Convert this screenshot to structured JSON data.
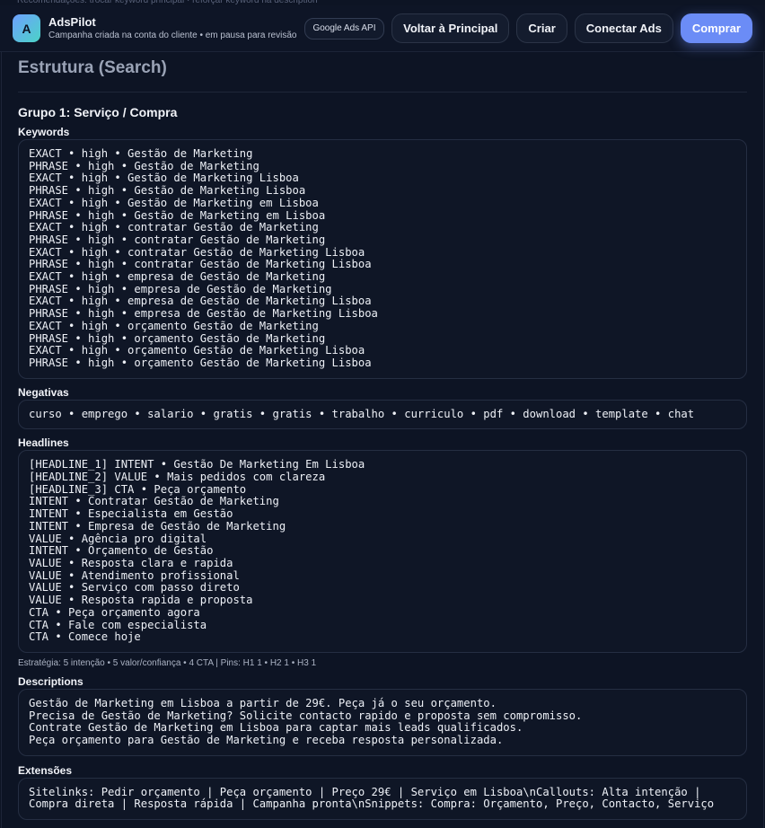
{
  "top_hint": "Recomendações: trocar keyword principal · reforçar keyword na description",
  "header": {
    "logo_letter": "A",
    "app_name": "AdsPilot",
    "subtitle": "Campanha criada na conta do cliente • em pausa para revisão",
    "api_badge": "Google Ads API",
    "buttons": {
      "back": "Voltar à Principal",
      "create": "Criar",
      "connect": "Conectar Ads",
      "buy": "Comprar"
    }
  },
  "main": {
    "section_title": "Estrutura (Search)",
    "group_title": "Grupo 1: Serviço / Compra",
    "keywords_label": "Keywords",
    "keywords": [
      "EXACT • high • Gestão de Marketing",
      "PHRASE • high • Gestão de Marketing",
      "EXACT • high • Gestão de Marketing Lisboa",
      "PHRASE • high • Gestão de Marketing Lisboa",
      "EXACT • high • Gestão de Marketing em Lisboa",
      "PHRASE • high • Gestão de Marketing em Lisboa",
      "EXACT • high • contratar Gestão de Marketing",
      "PHRASE • high • contratar Gestão de Marketing",
      "EXACT • high • contratar Gestão de Marketing Lisboa",
      "PHRASE • high • contratar Gestão de Marketing Lisboa",
      "EXACT • high • empresa de Gestão de Marketing",
      "PHRASE • high • empresa de Gestão de Marketing",
      "EXACT • high • empresa de Gestão de Marketing Lisboa",
      "PHRASE • high • empresa de Gestão de Marketing Lisboa",
      "EXACT • high • orçamento Gestão de Marketing",
      "PHRASE • high • orçamento Gestão de Marketing",
      "EXACT • high • orçamento Gestão de Marketing Lisboa",
      "PHRASE • high • orçamento Gestão de Marketing Lisboa"
    ],
    "negatives_label": "Negativas",
    "negatives": "curso • emprego • salario • gratis • gratis • trabalho • curriculo • pdf • download • template • chat",
    "headlines_label": "Headlines",
    "headlines": [
      "[HEADLINE_1] INTENT • Gestão De Marketing Em Lisboa",
      "[HEADLINE_2] VALUE • Mais pedidos com clareza",
      "[HEADLINE_3] CTA • Peça orçamento",
      "INTENT • Contratar Gestão de Marketing",
      "INTENT • Especialista em Gestão",
      "INTENT • Empresa de Gestão de Marketing",
      "VALUE • Agência pro digital",
      "INTENT • Orçamento de Gestão",
      "VALUE • Resposta clara e rapida",
      "VALUE • Atendimento profissional",
      "VALUE • Serviço com passo direto",
      "VALUE • Resposta rapida e proposta",
      "CTA • Peça orçamento agora",
      "CTA • Fale com especialista",
      "CTA • Comece hoje"
    ],
    "strategy_note": "Estratégia: 5 intenção • 5 valor/confiança • 4 CTA | Pins: H1 1 • H2 1 • H3 1",
    "descriptions_label": "Descriptions",
    "descriptions": [
      "Gestão de Marketing em Lisboa a partir de 29€. Peça já o seu orçamento.",
      "Precisa de Gestão de Marketing? Solicite contacto rapido e proposta sem compromisso.",
      "Contrate Gestão de Marketing em Lisboa para captar mais leads qualificados.",
      "Peça orçamento para Gestão de Marketing e receba resposta personalizada."
    ],
    "extensions_label": "Extensões",
    "extensions": [
      "Sitelinks: Pedir orçamento | Peça orçamento | Preço 29€ | Serviço em Lisboa\\nCallouts: Alta intenção |",
      "Compra direta | Resposta rápida | Campanha pronta\\nSnippets: Compra: Orçamento, Preço, Contacto, Serviço"
    ]
  },
  "colors": {
    "background": "#0d1424",
    "primary": "#6b8cf6",
    "panel": "#0f1626"
  }
}
